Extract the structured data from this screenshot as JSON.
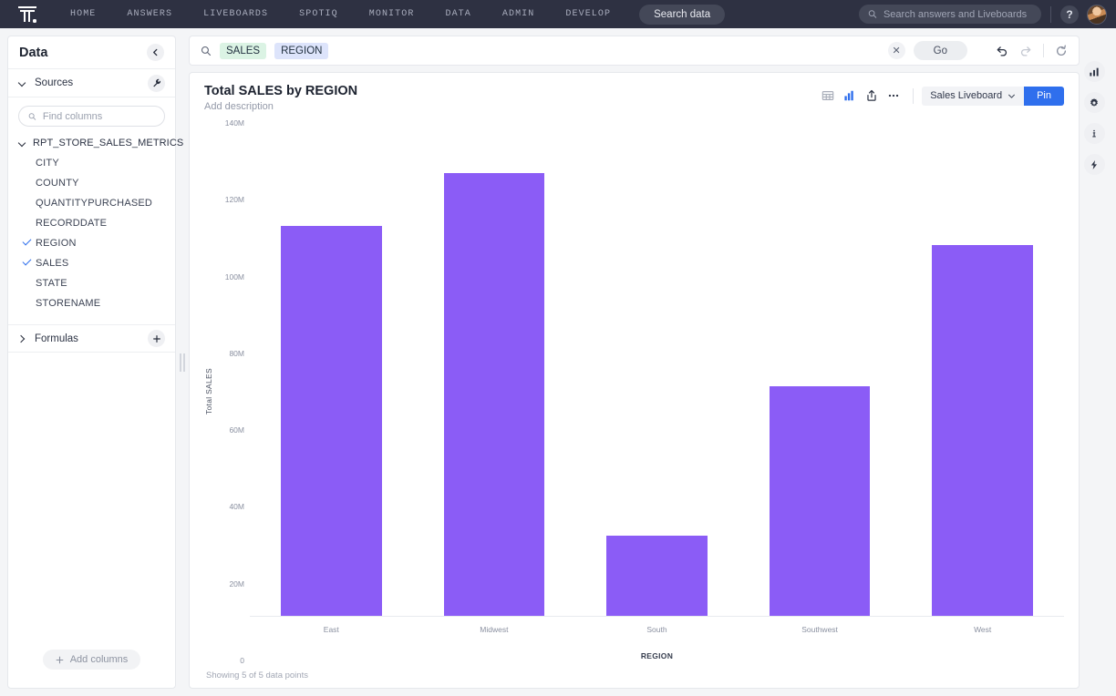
{
  "topnav": {
    "logo_name": "thoughtspot-logo",
    "links": [
      "HOME",
      "ANSWERS",
      "LIVEBOARDS",
      "SPOTIQ",
      "MONITOR",
      "DATA",
      "ADMIN",
      "DEVELOP"
    ],
    "search_data_pill": "Search data",
    "global_search_placeholder": "Search answers and Liveboards",
    "global_search_value": "",
    "help_label": "?",
    "background": "#2e3142"
  },
  "sidebar": {
    "title": "Data",
    "collapse_tooltip": "Collapse",
    "sources_label": "Sources",
    "find_columns_placeholder": "Find columns",
    "find_columns_value": "",
    "table_name": "RPT_STORE_SALES_METRICS",
    "columns": [
      {
        "name": "CITY",
        "selected": false
      },
      {
        "name": "COUNTY",
        "selected": false
      },
      {
        "name": "QUANTITYPURCHASED",
        "selected": false
      },
      {
        "name": "RECORDDATE",
        "selected": false
      },
      {
        "name": "REGION",
        "selected": true
      },
      {
        "name": "SALES",
        "selected": true
      },
      {
        "name": "STATE",
        "selected": false
      },
      {
        "name": "STORENAME",
        "selected": false
      }
    ],
    "formulas_label": "Formulas",
    "add_columns_label": "Add columns",
    "selected_color": "#2f6fed"
  },
  "searchbar": {
    "tokens": [
      {
        "text": "SALES",
        "color": "#dbf3e4"
      },
      {
        "text": "REGION",
        "color": "#dde4fb"
      }
    ],
    "clear_label": "✕",
    "go_label": "Go",
    "undo_name": "undo-icon",
    "redo_name": "redo-icon",
    "reset_name": "reset-icon"
  },
  "chart_card": {
    "title": "Total SALES by REGION",
    "description_placeholder": "Add description",
    "liveboard_name": "Sales Liveboard",
    "pin_label": "Pin",
    "footnote": "Showing 5 of 5 data points",
    "accent_color": "#2f6fed",
    "tools": [
      "table-view-icon",
      "chart-view-icon",
      "share-icon",
      "more-options-icon"
    ],
    "active_tool": "chart-view-icon"
  },
  "right_rail": {
    "items": [
      "chart-config-icon",
      "settings-gear-icon",
      "info-icon",
      "spotiq-bolt-icon"
    ]
  },
  "chart_data": {
    "type": "bar",
    "title": "Total SALES by REGION",
    "categories": [
      "East",
      "Midwest",
      "South",
      "Southwest",
      "West"
    ],
    "values": [
      110800000,
      125700000,
      22900000,
      65300000,
      105300000
    ],
    "xlabel": "REGION",
    "ylabel": "Total SALES",
    "ylim": [
      0,
      140000000
    ],
    "yticks": [
      0,
      20000000,
      40000000,
      60000000,
      80000000,
      100000000,
      120000000,
      140000000
    ],
    "ytick_labels": [
      "0",
      "20M",
      "40M",
      "60M",
      "80M",
      "100M",
      "120M",
      "140M"
    ],
    "bar_color": "#8b5cf6",
    "grid": false,
    "legend": false
  }
}
